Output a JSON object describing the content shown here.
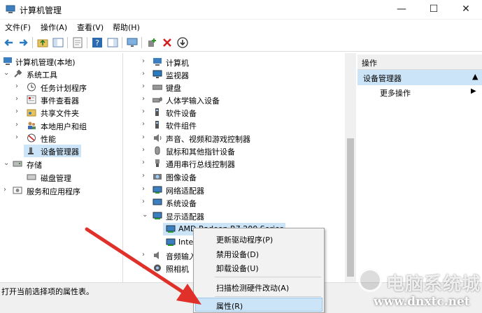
{
  "window": {
    "title": "计算机管理",
    "minimize": "—",
    "maximize": "☐",
    "close": "✕"
  },
  "menubar": [
    "文件(F)",
    "操作(A)",
    "查看(V)",
    "帮助(H)"
  ],
  "tree_left": {
    "root": "计算机管理(本地)",
    "system_tools": "系统工具",
    "children": [
      "任务计划程序",
      "事件查看器",
      "共享文件夹",
      "本地用户和组",
      "性能",
      "设备管理器"
    ],
    "storage": "存储",
    "disk_management": "磁盘管理",
    "services": "服务和应用程序"
  },
  "devices": [
    "计算机",
    "监视器",
    "键盘",
    "人体学输入设备",
    "软件设备",
    "软件组件",
    "声音、视频和游戏控制器",
    "鼠标和其他指针设备",
    "通用串行总线控制器",
    "图像设备",
    "网络适配器",
    "系统设备",
    "显示适配器"
  ],
  "display_children": [
    "AMD Radeon R7 200 Series",
    "Inte"
  ],
  "devices_after": [
    "音频输入",
    "照相机"
  ],
  "actions": {
    "header": "操作",
    "group": "设备管理器",
    "more": "更多操作"
  },
  "context_menu": {
    "update_driver": "更新驱动程序(P)",
    "disable": "禁用设备(D)",
    "uninstall": "卸载设备(U)",
    "scan": "扫描检测硬件改动(A)",
    "properties": "属性(R)"
  },
  "status": "打开当前选择项的属性表。",
  "watermark": {
    "title": "电脑系统城",
    "url": "www.dnxtc.net"
  },
  "colors": {
    "selection": "#cce4f7",
    "arrow": "#e0302a"
  }
}
